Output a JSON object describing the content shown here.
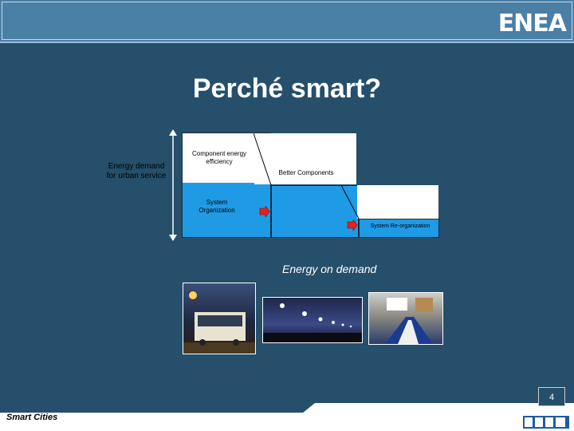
{
  "slide": {
    "title": "Perché smart?",
    "brand": "ENEA",
    "footer": "Smart Cities",
    "page_number": "4",
    "subtitle": "Energy on demand"
  },
  "diagram": {
    "axis_label": "Energy demand for urban service",
    "box1_label": "Component energy efficiency",
    "box1_lower_label": "System Organization",
    "box2_label": "Better Components",
    "box3_label": "System Re-organization"
  },
  "photos": [
    {
      "name": "bus-photo"
    },
    {
      "name": "streetlights-photo"
    },
    {
      "name": "conference-room-photo"
    }
  ],
  "colors": {
    "background": "#254f6b",
    "panel": "#1f9be6",
    "arrow": "#e32219"
  }
}
